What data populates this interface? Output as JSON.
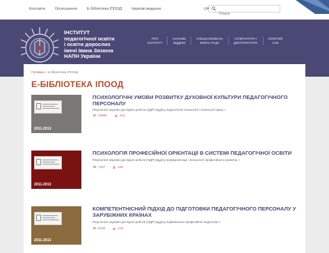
{
  "topbar": {
    "links": [
      "Контакти",
      "Оголошення",
      "Е-бібліотека ІПООД",
      "Наукові видання"
    ],
    "lang": "UA",
    "search_placeholder": "Пошук"
  },
  "header": {
    "institute_lines": [
      "ІНСТИТУТ",
      "педагогічної освіти",
      "і освіти дорослих",
      "імені Івана Зязюна",
      "НАПН України"
    ],
    "nav": [
      {
        "line1": "ПРО",
        "line2": "ІНСТИТУТ"
      },
      {
        "line1": "НАУКОВІ",
        "line2": "ВІДДІЛИ"
      },
      {
        "line1": "СПЕЦІАЛІЗОВАНА",
        "line2": "ВЧЕНА РАДА"
      },
      {
        "line1": "АСПІРАНТУРА І",
        "line2": "ДОКТОРАНТУРА"
      },
      {
        "line1": "ОСВІТНІЙ",
        "line2": "ХАБ"
      }
    ]
  },
  "breadcrumb": {
    "home": "Головна",
    "sep": "»",
    "current": "е-бібліотека ІПООД"
  },
  "page_title": "Е-БІБЛІОТЕКА ІПООД",
  "colors": {
    "header": "#4a4875",
    "accent": "#b24b2a",
    "cover_gray": "#7a7775",
    "cover_red": "#7a1212",
    "cover_brown": "#8a6a3e"
  },
  "items": [
    {
      "title": "ПСИХОЛОГІЧНІ УМОВИ РОЗВИТКУ ДУХОВНОЇ КУЛЬТУРИ ПЕДАГОГІЧНОГО ПЕРСОНАЛУ",
      "description": "Результати науково-дослідної роботи (НДР) відділу педагогічної психології і психології праці",
      "more": "»",
      "views": "10850",
      "downloads": "234",
      "year": "2011-2013"
    },
    {
      "title": "ПСИХОЛОГІЯ ПРОФЕСІЙНОЇ ОРІЄНТАЦІЇ В СИСТЕМІ ПЕДАГОГІЧНОЇ ОСВІТИ",
      "description": "Результати науково-дослідної роботи (НДР) відділу профорієнтації і психології професійного розвитку",
      "more": "»",
      "views": "7267",
      "downloads": "446",
      "year": "2011-2013"
    },
    {
      "title": "КОМПЕТЕНТНІСНИЙ ПІДХІД ДО ПІДГОТОВКИ ПЕДАГОГІЧНОГО ПЕРСОНАЛУ У ЗАРУБІЖНИХ КРАЇНАХ",
      "description": "Результати науково-дослідної роботи (НДР) відділу порівняльної професійної педагогіки",
      "more": "»",
      "views": "6759",
      "downloads": "219",
      "year": "2011-2013"
    }
  ]
}
